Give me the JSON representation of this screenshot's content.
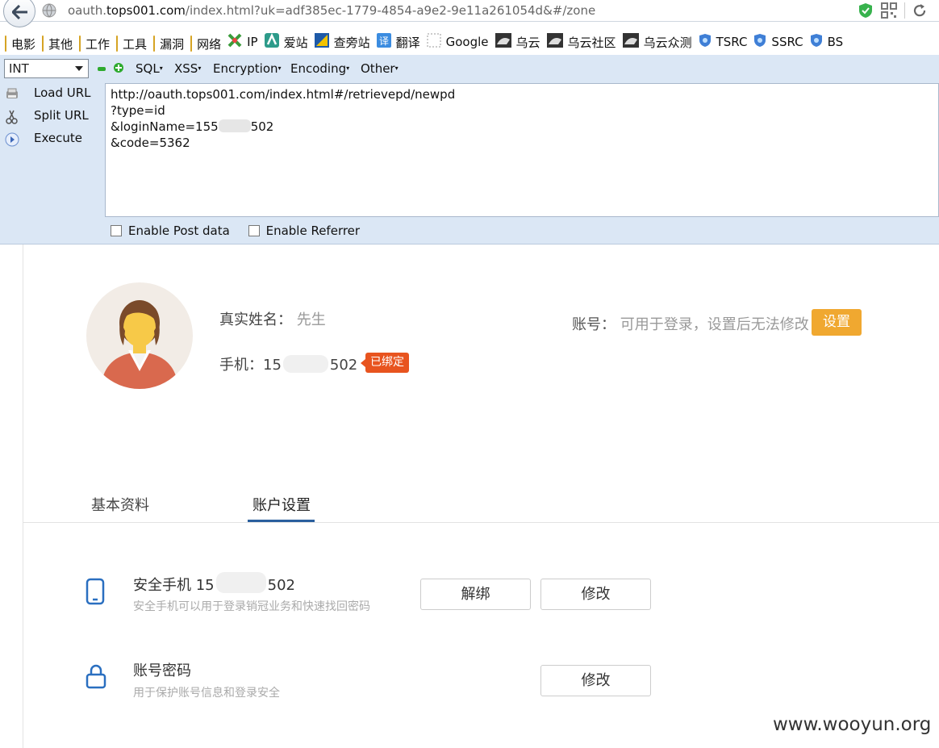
{
  "browser": {
    "url_prefix": "oauth.",
    "url_domain": "tops001.com",
    "url_rest": "/index.html?uk=adf385ec-1779-4854-a9e2-9e11a261054d&#/zone"
  },
  "bookmarks": [
    {
      "label": "电影",
      "icon": "folder-icon"
    },
    {
      "label": "其他",
      "icon": "folder-icon"
    },
    {
      "label": "工作",
      "icon": "folder-icon"
    },
    {
      "label": "工具",
      "icon": "folder-icon"
    },
    {
      "label": "漏洞",
      "icon": "folder-icon"
    },
    {
      "label": "网络",
      "icon": "folder-icon"
    },
    {
      "label": "IP",
      "icon": "ip-icon"
    },
    {
      "label": "爱站",
      "icon": "aizhan-icon"
    },
    {
      "label": "查旁站",
      "icon": "chapangzhan-icon"
    },
    {
      "label": "翻译",
      "icon": "translate-icon"
    },
    {
      "label": "Google",
      "icon": "google-icon"
    },
    {
      "label": "乌云",
      "icon": "wooyun-icon"
    },
    {
      "label": "乌云社区",
      "icon": "wooyun-icon"
    },
    {
      "label": "乌云众测",
      "icon": "wooyun-icon"
    },
    {
      "label": "TSRC",
      "icon": "shield-icon"
    },
    {
      "label": "SSRC",
      "icon": "shield-icon"
    },
    {
      "label": "BS",
      "icon": "shield-icon"
    }
  ],
  "hackbar": {
    "select_value": "INT",
    "menus": [
      "SQL",
      "XSS",
      "Encryption",
      "Encoding",
      "Other"
    ],
    "load_url": "Load URL",
    "split_url": "Split URL",
    "execute": "Execute",
    "url_lines": {
      "l1": "http://oauth.tops001.com/index.html#/retrievepd/newpd",
      "l2": "?type=id",
      "l3_a": "&loginName=155",
      "l3_b": "502",
      "l4": "&code=5362"
    },
    "enable_post": "Enable Post data",
    "enable_referrer": "Enable Referrer"
  },
  "profile": {
    "name_label": "真实姓名：",
    "name_value": "先生",
    "phone_label": "手机：",
    "phone_a": "15",
    "phone_b": "502",
    "bound_badge": "已绑定",
    "account_label": "账号：",
    "account_hint": "可用于登录，设置后无法修改",
    "set_button": "设置"
  },
  "tabs": {
    "basic": "基本资料",
    "account": "账户设置"
  },
  "security": {
    "phone_title_a": "安全手机 15",
    "phone_title_b": "502",
    "phone_desc": "安全手机可以用于登录销冠业务和快速找回密码",
    "unbind_button": "解绑",
    "modify_button": "修改",
    "password_title": "账号密码",
    "password_desc": "用于保护账号信息和登录安全",
    "password_modify_button": "修改"
  },
  "watermark": "www.wooyun.org",
  "colors": {
    "accent": "#f0a830",
    "badge": "#e8541f",
    "tab_underline": "#2a5f9e",
    "hackbar_bg": "#dbe7f5"
  }
}
